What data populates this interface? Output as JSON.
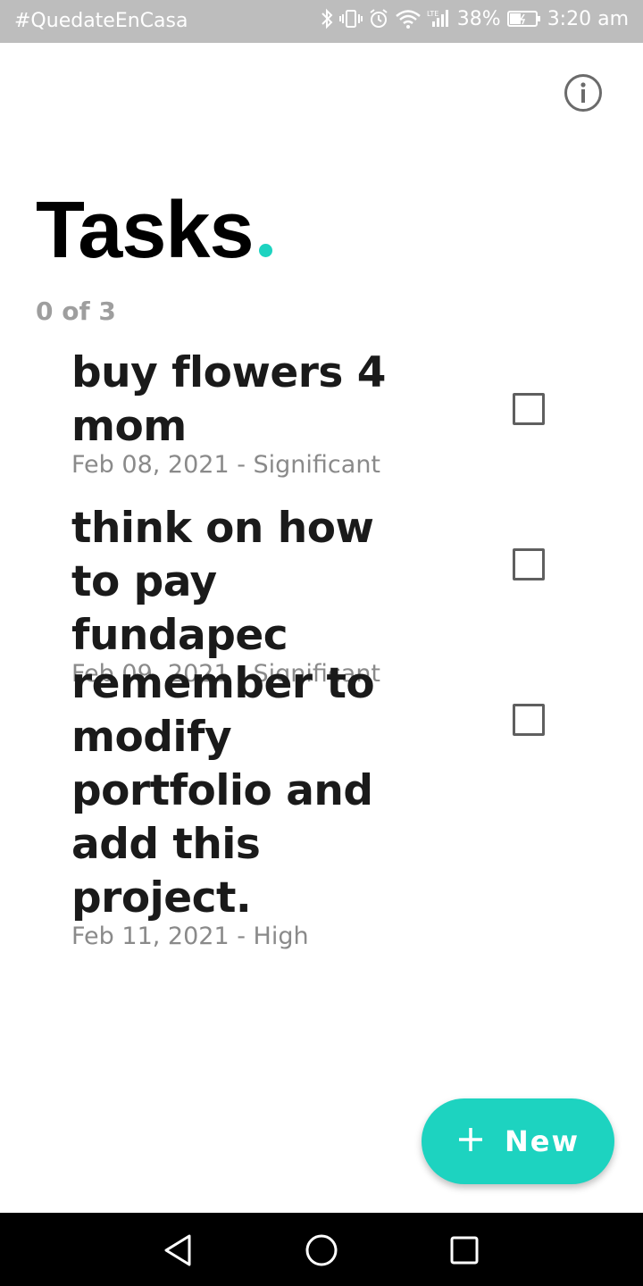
{
  "status_bar": {
    "left_text": "#QuedateEnCasa",
    "battery": "38%",
    "time": "3:20 am",
    "icons": [
      "bluetooth-icon",
      "vibrate-icon",
      "alarm-icon",
      "wifi-icon",
      "signal-icon",
      "battery-icon"
    ]
  },
  "header": {
    "title": "Tasks",
    "accent_color": "#1dd3c0",
    "info_icon": "info-icon"
  },
  "summary": {
    "count_text": "0 of 3"
  },
  "tasks": [
    {
      "title": "buy flowers 4 mom",
      "meta": "Feb 08, 2021 - Significant",
      "checked": false
    },
    {
      "title": "think on how to pay fundapec",
      "meta": "Feb 09, 2021 - Significant",
      "checked": false
    },
    {
      "title": "remember to modify portfolio and add this project.",
      "meta": "Feb 11, 2021 - High",
      "checked": false
    }
  ],
  "fab": {
    "label": "New",
    "icon": "plus-icon",
    "color": "#1dd3c0"
  },
  "nav_bar": {
    "buttons": [
      "back-icon",
      "home-icon",
      "recents-icon"
    ]
  }
}
